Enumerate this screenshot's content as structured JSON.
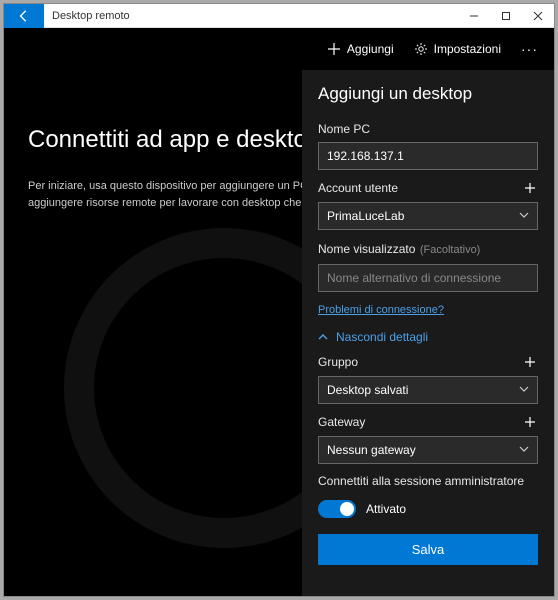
{
  "titlebar": {
    "title": "Desktop remoto"
  },
  "toolbar": {
    "add_label": "Aggiungi",
    "settings_label": "Impostazioni"
  },
  "main": {
    "heading": "Connettiti ad app e desktop",
    "subtext": "Per iniziare, usa questo dispositivo per aggiungere un PC remoto connetterti. Puoi anche aggiungere risorse remote per lavorare con desktop che altri hanno configurato per te."
  },
  "panel": {
    "title": "Aggiungi un desktop",
    "pc_name": {
      "label": "Nome PC",
      "value": "192.168.137.1"
    },
    "user_account": {
      "label": "Account utente",
      "selected": "PrimaLuceLab"
    },
    "display_name": {
      "label": "Nome visualizzato",
      "optional": "(Facoltativo)",
      "placeholder": "Nome alternativo di connessione"
    },
    "conn_problems_link": "Problemi di connessione?",
    "hide_details": "Nascondi dettagli",
    "group": {
      "label": "Gruppo",
      "selected": "Desktop salvati"
    },
    "gateway": {
      "label": "Gateway",
      "selected": "Nessun gateway"
    },
    "admin_session": {
      "label": "Connettiti alla sessione amministratore",
      "state": "Attivato"
    },
    "save_label": "Salva"
  }
}
